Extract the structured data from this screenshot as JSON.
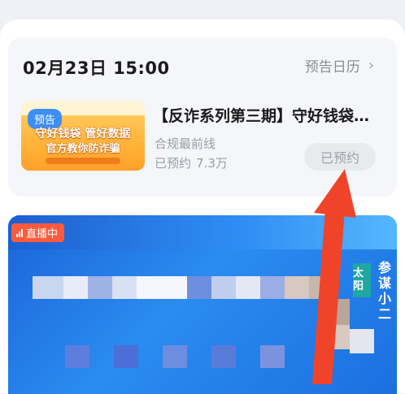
{
  "preview": {
    "date_time": "02月23日 15:00",
    "calendar_link": "预告日历",
    "thumbnail": {
      "tag": "预告",
      "line1": "守好钱袋 管好数据",
      "line2": "官方教你防诈骗"
    },
    "title": "【反诈系列第三期】守好钱袋…",
    "publisher": "合规最前线",
    "reserved_label": "已预约",
    "reserved_count": "7.3万",
    "reserved_button": "已预约"
  },
  "live": {
    "badge": "直播中",
    "side_label": "太阳",
    "side_label_2": "参谋小二"
  },
  "colors": {
    "accent_blue": "#3d8ef5",
    "live_red": "#ff5a3c",
    "arrow_red": "#f0442a"
  }
}
